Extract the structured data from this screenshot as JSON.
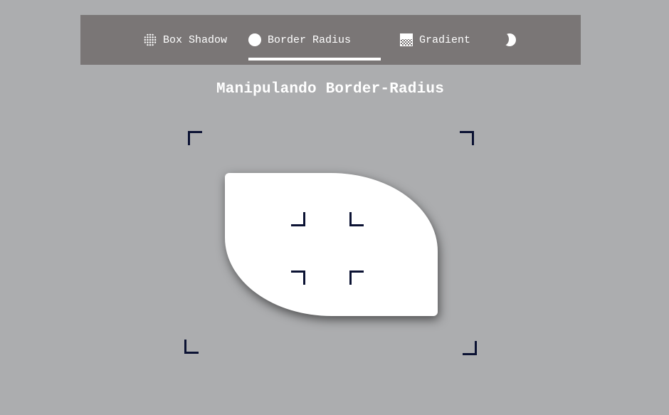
{
  "nav": {
    "tabs": [
      {
        "label": "Box Shadow",
        "icon": "dot-grid-icon",
        "active": false
      },
      {
        "label": "Border Radius",
        "icon": "circle-icon",
        "active": true
      },
      {
        "label": "Gradient",
        "icon": "gradient-icon",
        "active": false
      }
    ],
    "theme_toggle_icon": "moon-icon"
  },
  "page": {
    "title": "Manipulando Border-Radius"
  },
  "colors": {
    "background": "#acadaf",
    "navbar": "#7a7676",
    "handles": "#0b1233",
    "shape": "#ffffff"
  }
}
